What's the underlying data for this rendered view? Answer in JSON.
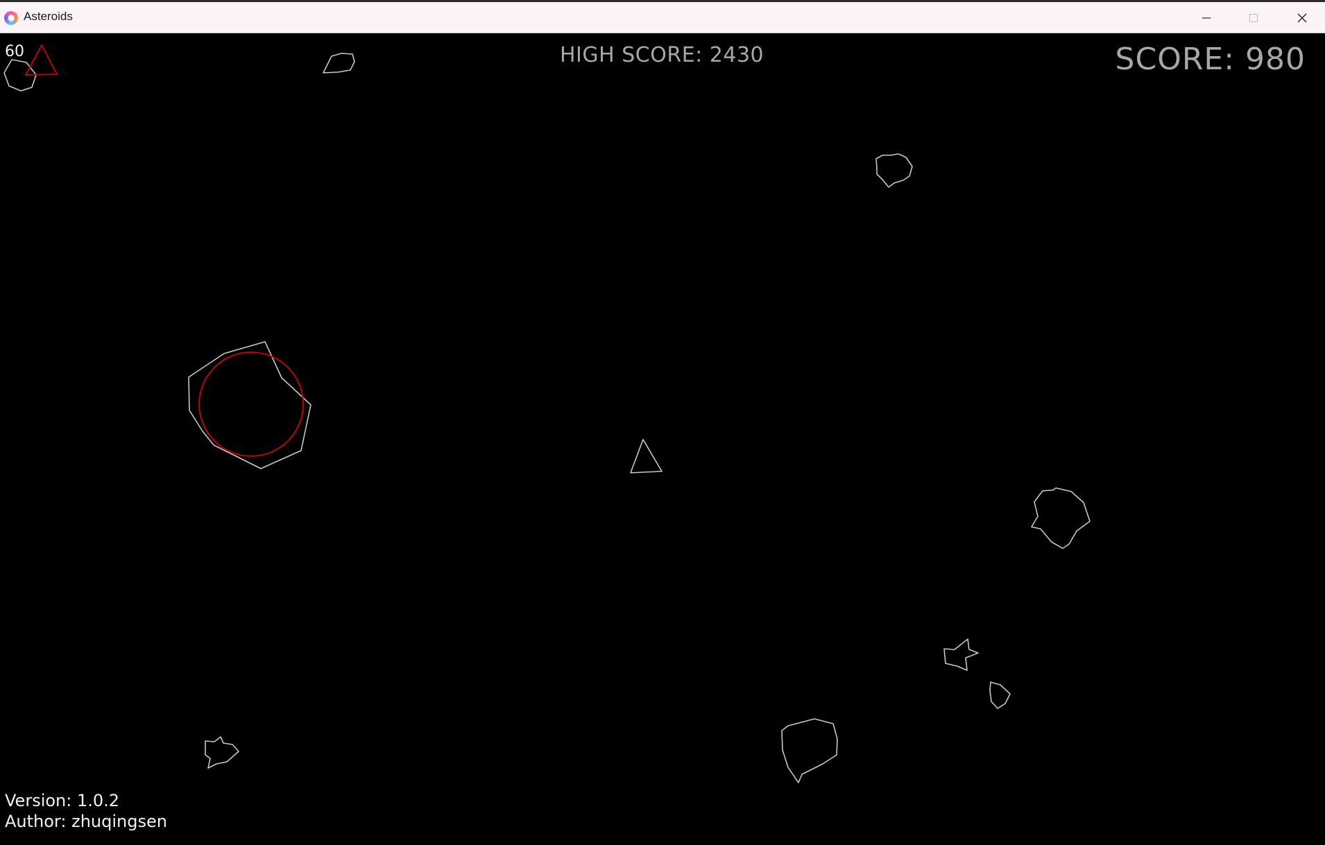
{
  "window": {
    "title": "Asteroids",
    "controls": {
      "minimize_icon": "minimize-icon",
      "maximize_icon": "maximize-icon",
      "close_icon": "close-icon"
    }
  },
  "hud": {
    "fps": "60",
    "high_score": "HIGH SCORE: 2430",
    "score": "SCORE: 980",
    "version": "Version: 1.0.2",
    "author": "Author: zhuqingsen"
  },
  "colors": {
    "background": "#000000",
    "outline": "#c8c8c8",
    "debug_red": "#d00000",
    "hud_grey": "#a8a8a8",
    "hud_white": "#f2f2f2"
  }
}
